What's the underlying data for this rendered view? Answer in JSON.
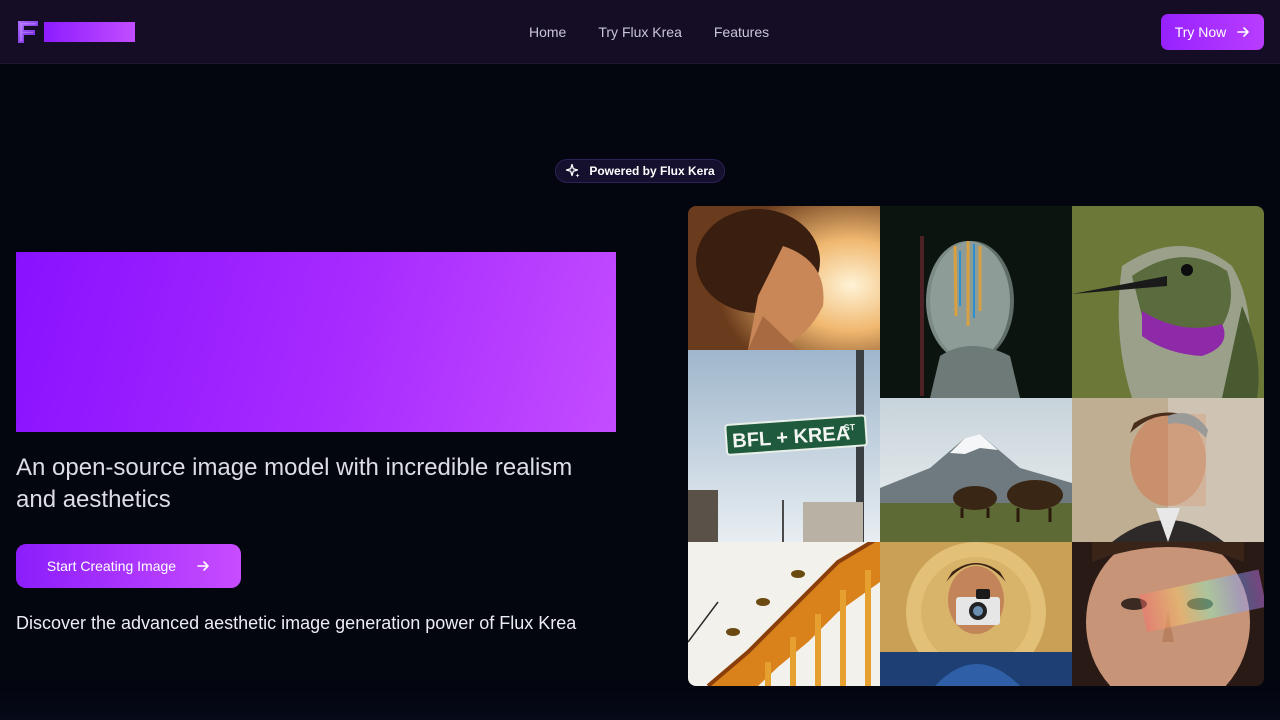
{
  "nav": {
    "logo_letter": "F",
    "links": [
      "Home",
      "Try Flux Krea",
      "Features"
    ],
    "try_now_label": "Try Now"
  },
  "badge": {
    "icon": "sparkle-icon",
    "label": "Powered by Flux Kera"
  },
  "hero": {
    "tagline": "An open-source image model with incredible realism and aesthetics",
    "cta_label": "Start Creating Image",
    "description": "Discover the advanced aesthetic image generation power of Flux Krea"
  },
  "gallery": {
    "street_sign_text": "BFL + KREA",
    "street_sign_suffix": "ST"
  },
  "colors": {
    "accent_start": "#8c1dfc",
    "accent_end": "#c84cff",
    "background": "#03050f",
    "navbar": "#150d26"
  }
}
